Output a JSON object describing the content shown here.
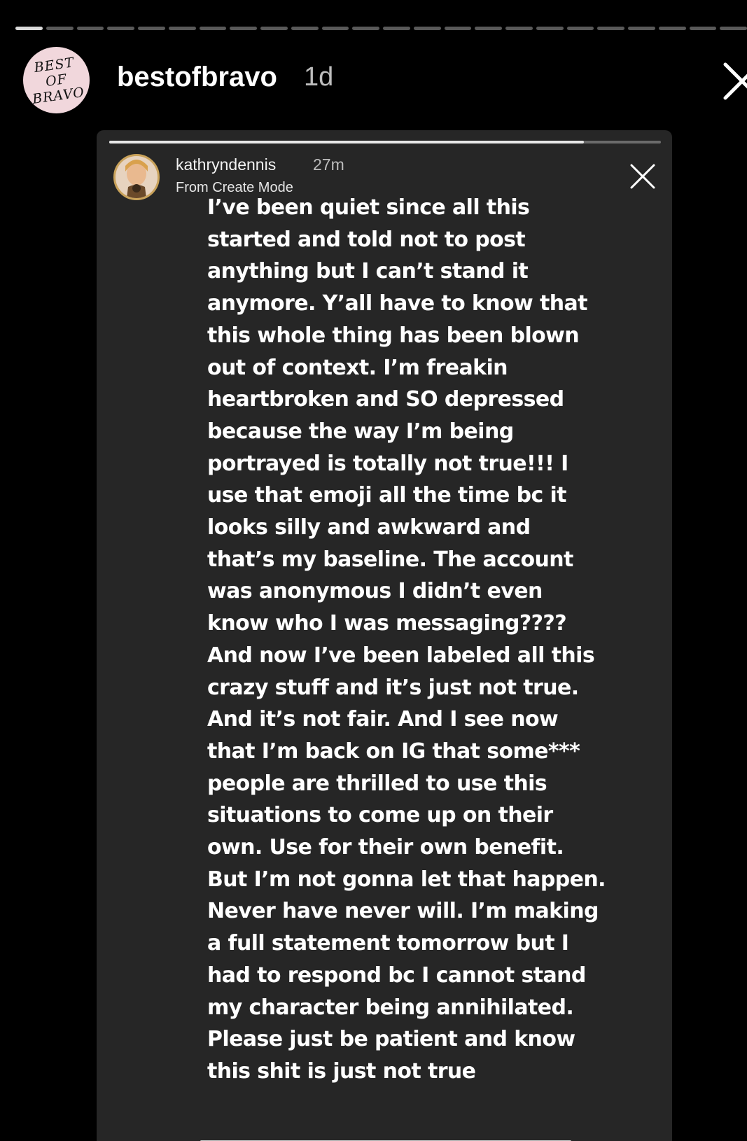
{
  "story": {
    "progress": {
      "segment_count": 24,
      "active_index": 0
    },
    "account": {
      "logo_text": [
        "BEST OF",
        "BRAVO"
      ],
      "username": "bestofbravo",
      "time": "1d"
    },
    "close_icon": "close-icon"
  },
  "embedded_story": {
    "progress_fraction": 0.86,
    "account": {
      "username": "kathryndennis",
      "time": "27m",
      "subtitle": "From Create Mode"
    },
    "close_icon": "close-icon",
    "text_lines": [
      "I’ve been quiet since all this",
      "started and told not to post",
      "anything but I can’t stand it",
      "anymore. Y’all have to know that",
      "this whole thing has been blown",
      "out of context. I’m freakin",
      "heartbroken and SO depressed",
      "because the way I’m being",
      "portrayed is totally not true!!! I",
      "use that emoji all the time bc it",
      "looks silly and awkward and",
      "that’s my baseline. The account",
      "was anonymous I didn’t even",
      "know who I was messaging????",
      "And now I’ve been labeled all this",
      "crazy stuff and it’s just not true.",
      "And it’s not fair. And I see now",
      "that I’m back on IG that some***",
      "people are thrilled to use this",
      "situations to come up on their",
      "own. Use for their own benefit.",
      "But I’m not gonna let that happen.",
      "Never have never will. I’m making",
      "a full statement tomorrow but I",
      "had to respond bc I cannot stand",
      "my character being annihilated.",
      "Please just be patient and know",
      "this shit is just not true"
    ]
  },
  "colors": {
    "background": "#000000",
    "card_background": "#262626",
    "logo_circle": "#f1d7dc",
    "avatar_ring": "#c9a25a",
    "text": "#ffffff",
    "muted_text": "#bdbdbd"
  }
}
